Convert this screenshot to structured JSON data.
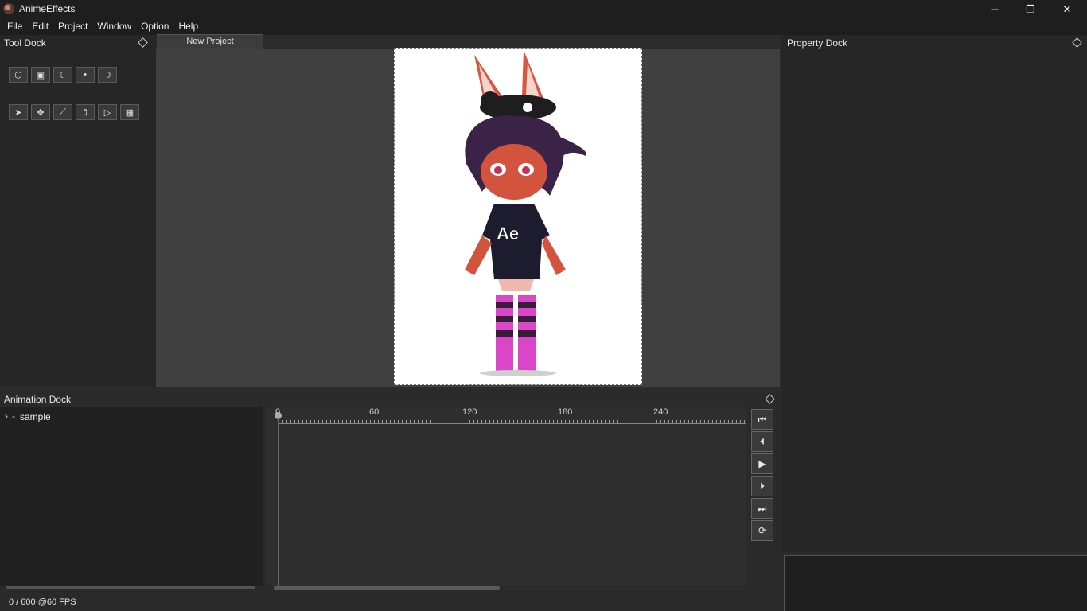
{
  "window": {
    "title": "AnimeEffects",
    "minimize": "─",
    "maximize": "❐",
    "close": "✕"
  },
  "menu": [
    "File",
    "Edit",
    "Project",
    "Window",
    "Option",
    "Help"
  ],
  "tool_dock": {
    "title": "Tool Dock"
  },
  "property_dock": {
    "title": "Property Dock"
  },
  "animation_dock": {
    "title": "Animation Dock"
  },
  "project_tab": "New Project",
  "tree": {
    "root_label": "sample",
    "expand_icon": "chevron-right-icon"
  },
  "timeline": {
    "ticks": [
      "0",
      "60",
      "120",
      "180",
      "240"
    ]
  },
  "status": {
    "frame_text": "0 / 600 @60 FPS"
  },
  "canvas_text": "Ae",
  "colors": {
    "background": "#2b2b2b",
    "titlebar": "#1e1e1e",
    "canvas": "#ffffff"
  }
}
